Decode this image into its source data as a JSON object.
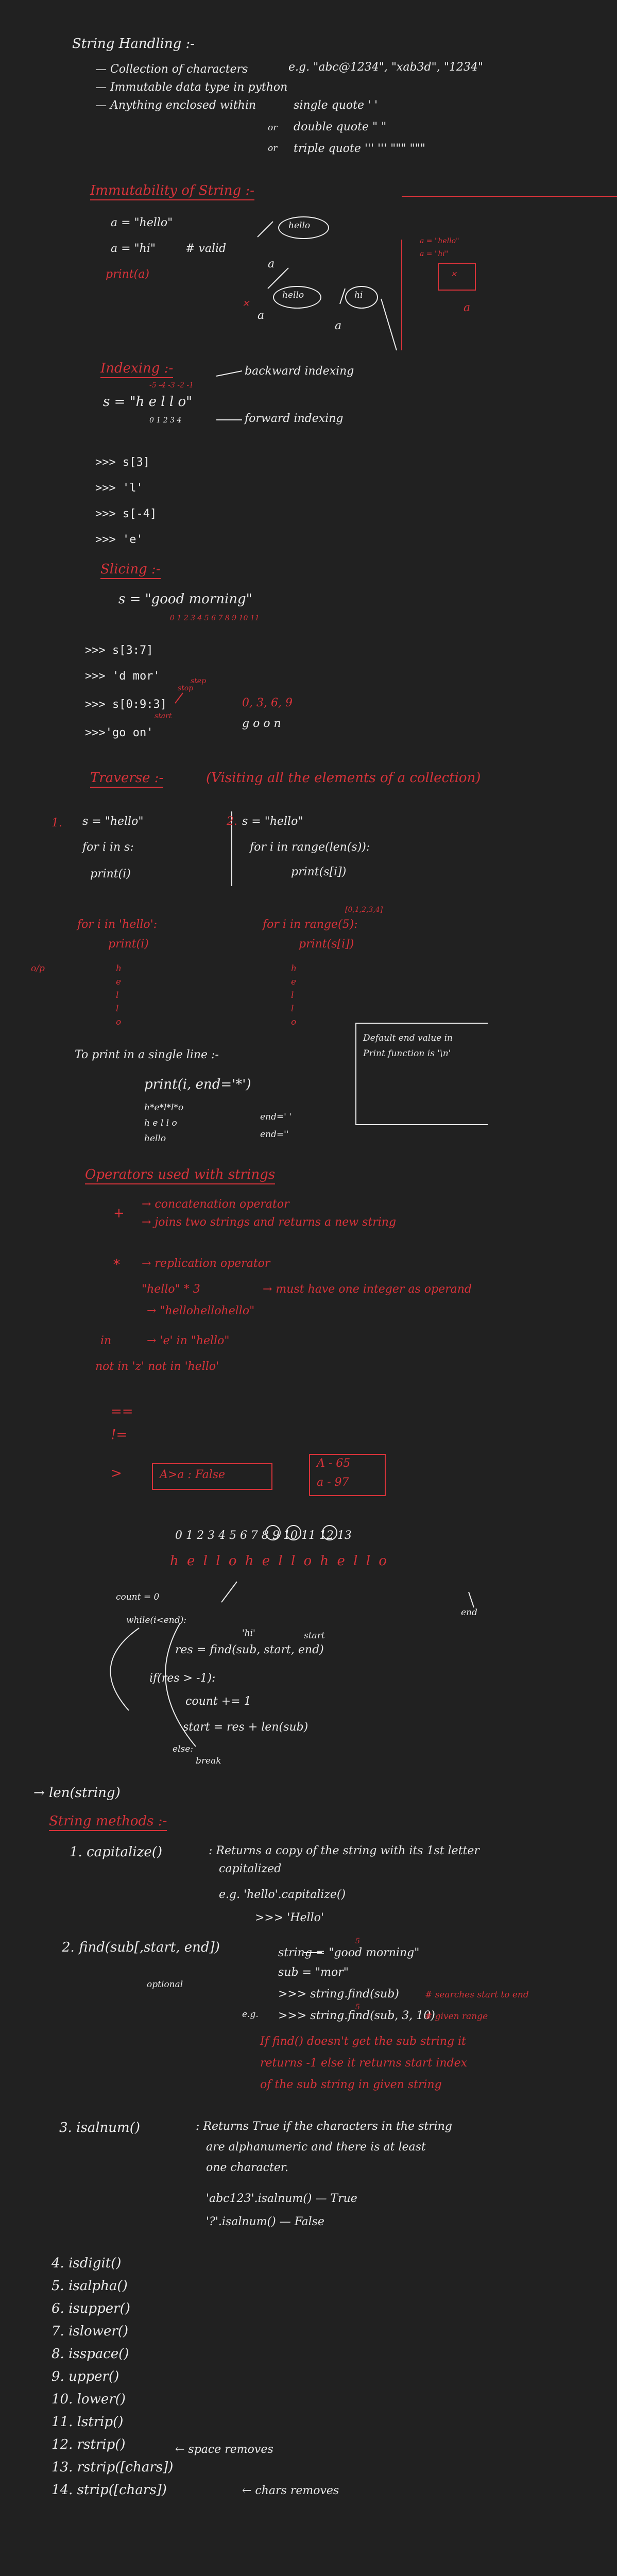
{
  "heading": "String Handling :-",
  "intro": [
    "— Collection of characters",
    "— Immutable data type in python",
    "— Anything enclosed within",
    "single quote ' '",
    "double quote \" \"",
    "triple quote ''' ''' \"\"\" \"\"\"",
    "e.g. \"abc@1234\", \"xab3d\", \"1234\"",
    "or",
    "or"
  ],
  "immut": {
    "title": "Immutability of String :-",
    "lines": [
      "a = \"hello\"",
      "a = \"hi\"",
      "# valid",
      "print(a)"
    ],
    "bubbles": [
      "hello",
      "hello",
      "hi",
      "a",
      "a",
      "a"
    ],
    "box": [
      "a = \"hello\"",
      "a = \"hi\"",
      "a"
    ]
  },
  "indexing": {
    "title": "Indexing :-",
    "neg": "-5 -4 -3 -2 -1",
    "s": "s = \"h e l l o\"",
    "pos": "0 1 2 3 4",
    "back": "backward indexing",
    "fwd": "forward indexing",
    "ex": [
      ">>> s[3]",
      ">>> 'l'",
      ">>> s[-4]",
      ">>> 'e'"
    ]
  },
  "slicing": {
    "title": "Slicing :-",
    "s": "s = \"good morning\"",
    "idx": "0 1 2 3 4 5 6 7 8 9 10 11",
    "ex": [
      ">>> s[3:7]",
      ">>> 'd mor'",
      ">>> s[0:9:3]",
      ">>>'go on'"
    ],
    "notes": [
      "start",
      "stop",
      "step",
      "0, 3, 6, 9",
      "g o  o n"
    ]
  },
  "traverse": {
    "title": "Traverse :-",
    "desc": "(Visiting all the elements of a collection)",
    "num": "1.",
    "num2": "2.",
    "left": [
      "s = \"hello\"",
      "for i in s:",
      "print(i)"
    ],
    "right": [
      "s = \"hello\"",
      "for i in range(len(s)):",
      "print(s[i])"
    ],
    "red_left": [
      "for i in 'hello':",
      "print(i)"
    ],
    "red_right": [
      "[0,1,2,3,4]",
      "for i in range(5):",
      "print(s[i])"
    ],
    "op": "o/p",
    "chars": [
      "h",
      "e",
      "l",
      "l",
      "o"
    ]
  },
  "single": {
    "title": "To print in a single line :-",
    "code": "print(i, end='*')",
    "out1": "h*e*l*l*o",
    "out2": "h e l l o",
    "out3": "hello",
    "end1": "end=' '",
    "end2": "end=''",
    "box": [
      "Default end value in",
      "Print function is '\\n'"
    ]
  },
  "ops": {
    "title": "Operators used with strings",
    "plus": "+",
    "plus1": "→ concatenation operator",
    "plus2": "→ joins two strings and returns a new string",
    "star": "*",
    "star1": "→ replication operator",
    "star2": "\"hello\" * 3",
    "star3": "→ must have one integer as operand",
    "star4": "→ \"hellohellohello\"",
    "in1": "in",
    "in2": "→ 'e' in \"hello\"",
    "notin": "not in  'z' not in 'hello'",
    "eq": "==",
    "ne": "!=",
    "gt": ">",
    "cmp1": "A>a : False",
    "cmp2": "A - 65",
    "cmp3": "a - 97"
  },
  "find_demo": {
    "idx": "0 1 2 3 4 5 6 7 8 9 10 11 12 13",
    "str": "h e l l o h e l l o h e l l o",
    "end": "end",
    "lines": [
      "count = 0",
      "while(i<end):",
      "res = find(sub, start, end)",
      "if(res > -1):",
      "count += 1",
      "start = res + len(sub)",
      "else:",
      "break",
      "'hi'",
      "start"
    ]
  },
  "methods": {
    "len": "→ len(string)",
    "title": "String methods :-",
    "m1": "1. capitalize()",
    "m1d": [
      ": Returns a copy of the string with its 1st letter",
      "capitalized",
      "e.g.   'hello'.capitalize()",
      ">>> 'Hello'"
    ],
    "m2": "2. find(sub[,start, end])",
    "m2opt": "optional",
    "m2d": [
      "string = \"good morning\"",
      "sub = \"mor\"",
      ">>> string.find(sub)",
      ">>> string.find(sub, 3, 10)",
      "If find() doesn't get the sub string it",
      "returns -1 else it returns start index",
      "of the sub string in given string"
    ],
    "m2notes": [
      "5",
      "# searches start to end",
      "# given range",
      "e.g.",
      "5"
    ],
    "m3": "3. isalnum()",
    "m3d": [
      ": Returns True if the characters in the string",
      "are alphanumeric and there is at least",
      "one character.",
      "'abc123'.isalnum()  —  True",
      "'?'.isalnum()  — False"
    ],
    "list": [
      "4. isdigit()",
      "5. isalpha()",
      "6. isupper()",
      "7. islower()",
      "8. isspace()",
      "9. upper()",
      "10. lower()",
      "11. lstrip()",
      "12. rstrip()",
      "13. rstrip([chars])",
      "14. strip([chars])"
    ],
    "space": "← space removes",
    "chars": "← chars removes"
  }
}
